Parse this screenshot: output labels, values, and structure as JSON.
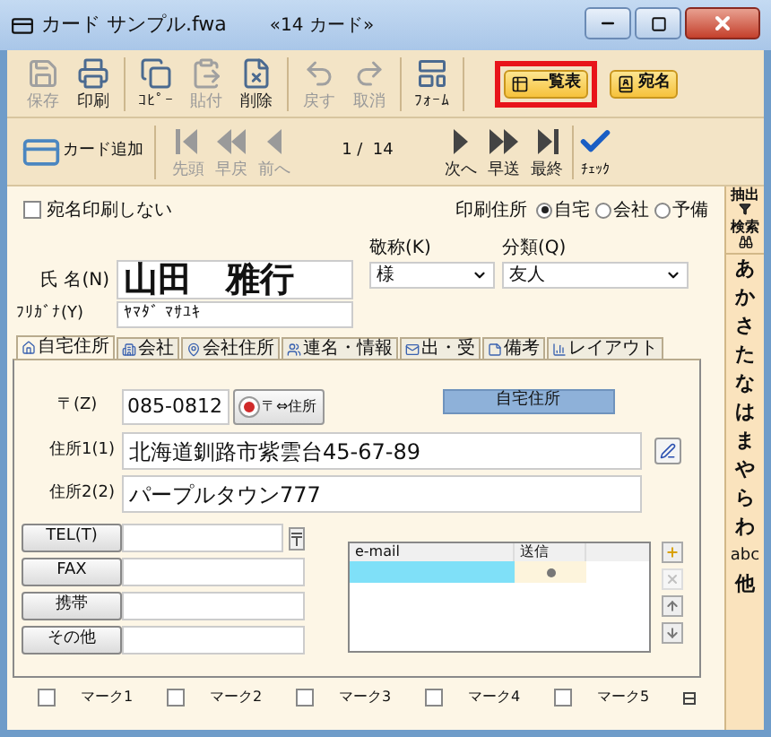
{
  "window": {
    "title": "カード サンプル.fwa",
    "subtitle": "«14 カード»"
  },
  "toolbar": [
    {
      "label": "保存",
      "kind": "save",
      "disabled": true
    },
    {
      "label": "印刷",
      "kind": "print",
      "disabled": false
    },
    {
      "label": "ｺﾋﾟｰ",
      "kind": "copy",
      "disabled": false
    },
    {
      "label": "貼付",
      "kind": "paste",
      "disabled": true
    },
    {
      "label": "削除",
      "kind": "delete",
      "disabled": false
    },
    {
      "label": "戻す",
      "kind": "undo",
      "disabled": true
    },
    {
      "label": "取消",
      "kind": "redo",
      "disabled": true
    },
    {
      "label": "ﾌｫｰﾑ",
      "kind": "form",
      "disabled": false
    }
  ],
  "view_buttons": [
    {
      "label": "一覧表",
      "highlighted": true
    },
    {
      "label": "宛名",
      "highlighted": false
    }
  ],
  "nav": {
    "add": "カード追加",
    "position": "1 /  14",
    "check": "ﾁｪｯｸ",
    "items": [
      {
        "label": "先頭",
        "kind": "first",
        "disabled": true
      },
      {
        "label": "早戻",
        "kind": "rewind",
        "disabled": true
      },
      {
        "label": "前へ",
        "kind": "prev",
        "disabled": true
      },
      {
        "label": "次へ",
        "kind": "next",
        "disabled": false
      },
      {
        "label": "早送",
        "kind": "forward",
        "disabled": false
      },
      {
        "label": "最終",
        "kind": "last",
        "disabled": false
      }
    ]
  },
  "no_address_print": {
    "label": "宛名印刷しない",
    "checked": false
  },
  "print_address": {
    "label": "印刷住所",
    "options": [
      {
        "label": "自宅",
        "selected": true
      },
      {
        "label": "会社",
        "selected": false
      },
      {
        "label": "予備",
        "selected": false
      }
    ]
  },
  "name": {
    "label": "氏 名(N)",
    "value": "山田　雅行"
  },
  "furigana": {
    "label": "ﾌﾘｶﾞﾅ(Y)",
    "value": "ﾔﾏﾀﾞ ﾏｻﾕｷ"
  },
  "honorific": {
    "label": "敬称(K)",
    "value": "様"
  },
  "category": {
    "label": "分類(Q)",
    "value": "友人"
  },
  "tabs": [
    {
      "label": "自宅住所",
      "selected": true
    },
    {
      "label": "会社",
      "selected": false
    },
    {
      "label": "会社住所",
      "selected": false
    },
    {
      "label": "連名・情報",
      "selected": false
    },
    {
      "label": "出・受",
      "selected": false
    },
    {
      "label": "備考",
      "selected": false
    },
    {
      "label": "レイアウト",
      "selected": false
    }
  ],
  "postal": {
    "label": "〒(Z)",
    "value": "085-0812",
    "button": "〒⇔住所",
    "badge": "自宅住所"
  },
  "address1": {
    "label": "住所1(1)",
    "value": "北海道釧路市紫雲台45-67-89"
  },
  "address2": {
    "label": "住所2(2)",
    "value": "パープルタウン777"
  },
  "phones": [
    {
      "label": "TEL(T)",
      "kind": "tel"
    },
    {
      "label": "FAX",
      "kind": "plain"
    },
    {
      "label": "携帯",
      "kind": "plain"
    },
    {
      "label": "その他",
      "kind": "plain"
    }
  ],
  "email": {
    "columns": [
      "e-mail",
      "送信"
    ],
    "rows": [
      {
        "selected": true,
        "send": true
      }
    ],
    "buttons": [
      {
        "kind": "add",
        "disabled": false
      },
      {
        "kind": "delete",
        "disabled": true
      },
      {
        "kind": "up",
        "disabled": false
      },
      {
        "kind": "down",
        "disabled": false
      }
    ]
  },
  "marks": [
    {
      "label": "マーク1",
      "checked": false
    },
    {
      "label": "マーク2",
      "checked": false
    },
    {
      "label": "マーク3",
      "checked": false
    },
    {
      "label": "マーク4",
      "checked": false
    },
    {
      "label": "マーク5",
      "checked": false
    }
  ],
  "index": {
    "filter": "抽出",
    "search": "検索",
    "letters": [
      "あ",
      "か",
      "さ",
      "た",
      "な",
      "は",
      "ま",
      "や",
      "ら",
      "わ",
      "abc",
      "他"
    ]
  }
}
